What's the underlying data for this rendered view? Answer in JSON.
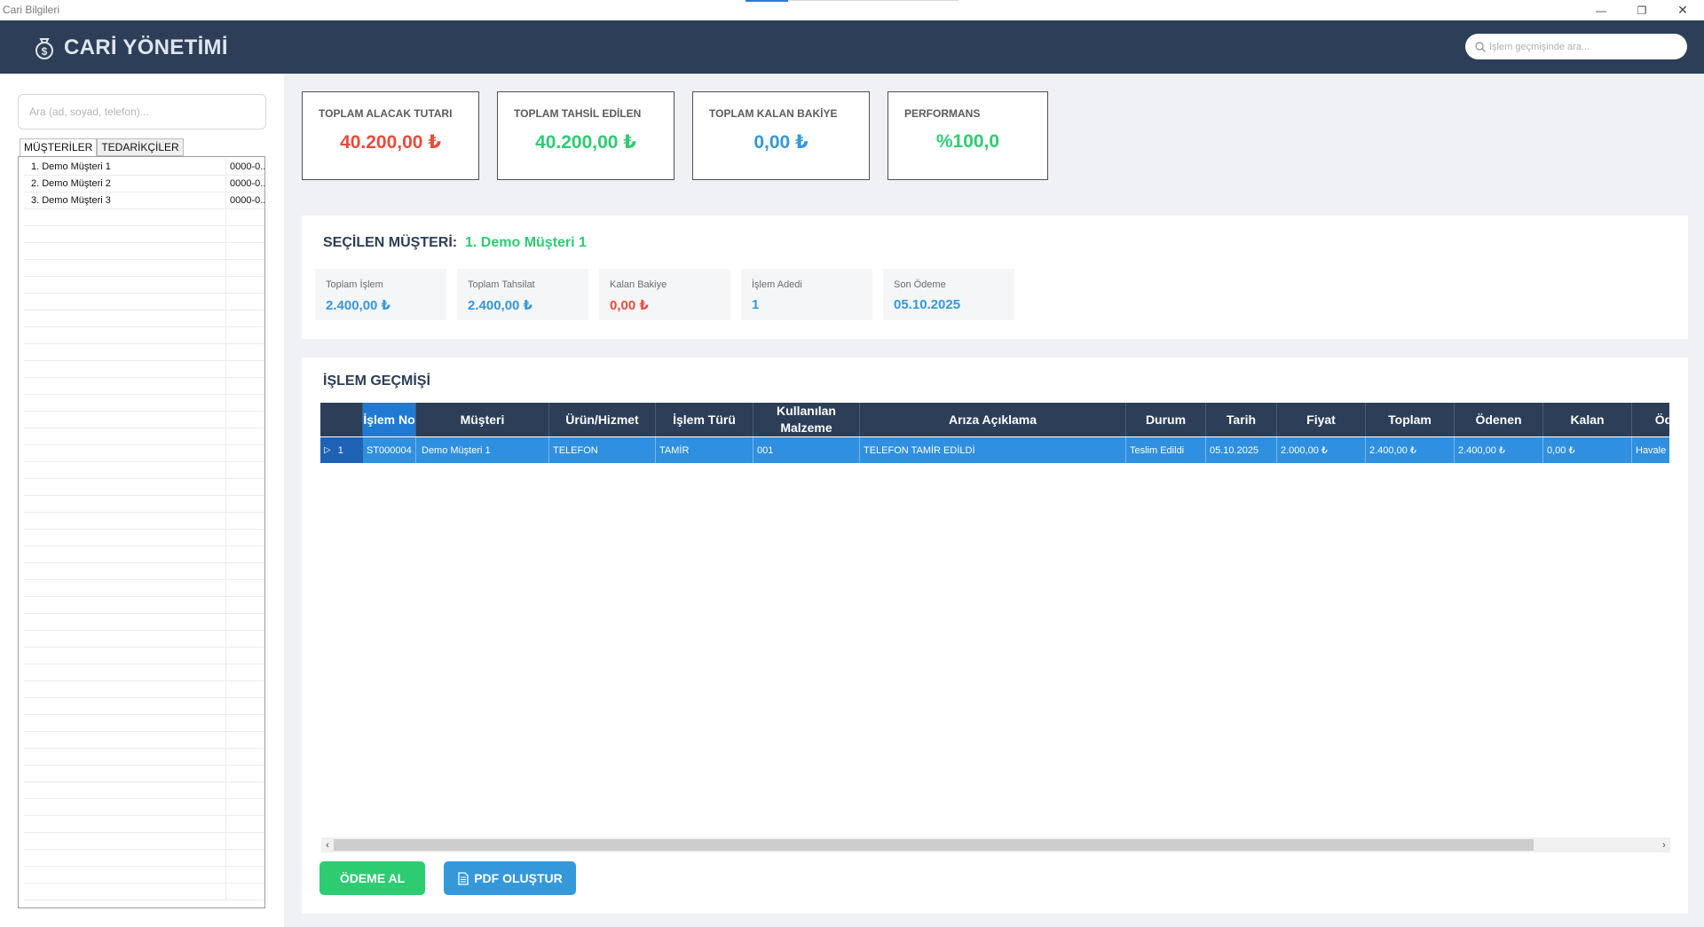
{
  "window": {
    "title": "Cari Bilgileri"
  },
  "header": {
    "app_title": "CARİ YÖNETİMİ",
    "search_placeholder": "İşlem geçmişinde ara..."
  },
  "sidebar": {
    "search_placeholder": "Ara (ad, soyad, telefon)...",
    "tabs": [
      "MÜŞTERİLER",
      "TEDARİKÇİLER"
    ],
    "rows": [
      {
        "name": "1. Demo  Müşteri 1",
        "phone": "0000-0..."
      },
      {
        "name": "2. Demo  Müşteri 2",
        "phone": "0000-0..."
      },
      {
        "name": "3. Demo  Müşteri 3",
        "phone": "0000-0..."
      }
    ]
  },
  "stats": {
    "alacak": {
      "label": "TOPLAM ALACAK TUTARI",
      "value": "40.200,00 ₺",
      "color": "#e74c3c"
    },
    "tahsil": {
      "label": "TOPLAM TAHSİL EDİLEN",
      "value": "40.200,00 ₺",
      "color": "#2ecc71"
    },
    "bakiye": {
      "label": "TOPLAM KALAN BAKİYE",
      "value": "0,00 ₺",
      "color": "#3498db"
    },
    "performans": {
      "label": "PERFORMANS",
      "value": "%100,0",
      "color": "#2ecc71"
    }
  },
  "selected": {
    "label": "SEÇİLEN MÜŞTERİ:",
    "name": "1. Demo  Müşteri 1",
    "items": [
      {
        "label": "Toplam İşlem",
        "value": "2.400,00 ₺",
        "color": "#3498db"
      },
      {
        "label": "Toplam Tahsilat",
        "value": "2.400,00 ₺",
        "color": "#3498db"
      },
      {
        "label": "Kalan Bakiye",
        "value": "0,00 ₺",
        "color": "#e74c3c"
      },
      {
        "label": "İşlem Adedi",
        "value": "1",
        "color": "#3498db"
      },
      {
        "label": "Son Ödeme",
        "value": "05.10.2025",
        "color": "#3498db"
      }
    ]
  },
  "history": {
    "title": "İŞLEM GEÇMİŞİ",
    "columns": [
      "İşlem No",
      "Müşteri",
      "Ürün/Hizmet",
      "İşlem Türü",
      "Kullanılan Malzeme",
      "Arıza Açıklama",
      "Durum",
      "Tarih",
      "Fiyat",
      "Toplam",
      "Ödenen",
      "Kalan",
      "Ödeme"
    ],
    "rows": [
      {
        "index": "1",
        "cells": [
          "ST000004",
          "Demo  Müşteri 1",
          "TELEFON",
          "TAMİR",
          "001",
          "TELEFON TAMİR EDİLDİ",
          "Teslim Edildi",
          "05.10.2025",
          "2.000,00 ₺",
          "2.400,00 ₺",
          "2.400,00 ₺",
          "0,00 ₺",
          "Havale"
        ]
      }
    ]
  },
  "actions": {
    "pay_label": "ÖDEME AL",
    "pdf_label": "PDF OLUŞTUR"
  }
}
